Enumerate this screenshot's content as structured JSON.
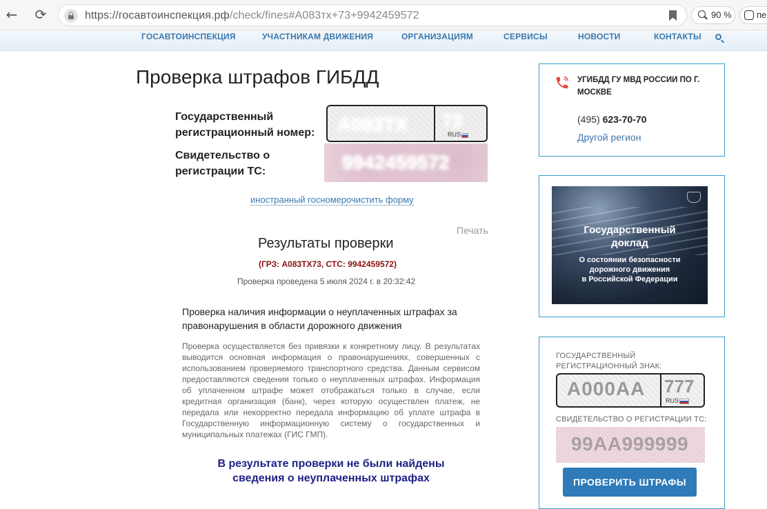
{
  "browser": {
    "url_host": "https://госавтоинспекция.рф",
    "url_path": "/check/fines#A083тх+73+9942459572",
    "zoom": "90 %",
    "translate_label": "пе"
  },
  "site_nav": {
    "items": [
      "ГОСАВТОИНСПЕКЦИЯ",
      "УЧАСТНИКАМ ДВИЖЕНИЯ",
      "ОРГАНИЗАЦИЯМ",
      "СЕРВИСЫ",
      "НОВОСТИ",
      "КОНТАКТЫ"
    ]
  },
  "main": {
    "title": "Проверка штрафов ГИБДД",
    "form": {
      "plate_label_line1": "Государственный",
      "plate_label_line2": "регистрационный номер:",
      "plate_value": "А083ТХ",
      "plate_region": "73",
      "plate_country": "RUS",
      "sts_label_line1": "Свидетельство о",
      "sts_label_line2": "регистрации ТС:",
      "sts_value": "9942459572",
      "foreign_link": "иностранный госномер",
      "clear_link": "очистить форму"
    },
    "print_label": "Печать",
    "results": {
      "title": "Результаты проверки",
      "subtitle": "(ГРЗ: А083ТХ73, СТС: 9942459572)",
      "date": "Проверка проведена 5 июля 2024 г. в 20:32:42",
      "section_heading": "Проверка наличия информации о неуплаченных штрафах за правонарушения в области дорожного движения",
      "section_body": "Проверка осуществляется без привязки к конкретному лицу. В результатах выводится основная информация о правонарушениях, совершенных с использованием проверяемого транспортного средства. Данным сервисом предоставляются сведения только о неуплаченных штрафах. Информация об уплаченном штрафе может отображаться только в случае, если кредитная организация (банк), через которую осуществлен платеж, не передала или некорректно передала информацию об уплате штрафа в Государственную информационную систему о государственных и муниципальных платежах (ГИС ГМП).",
      "message_line1": "В результате проверки не были найдены",
      "message_line2": "сведения о неуплаченных штрафах"
    }
  },
  "sidebar": {
    "contact": {
      "heading": "УГИБДД ГУ МВД РОССИИ ПО Г. МОСКВЕ",
      "phone_code": "(495)",
      "phone_number": "623-70-70",
      "region_link": "Другой регион"
    },
    "banner": {
      "title_line1": "Государственный",
      "title_line2": "доклад",
      "text_line1": "О состоянии безопасности",
      "text_line2": "дорожного движения",
      "text_line3": "в Российской Федерации"
    },
    "widget": {
      "plate_label_line1": "ГОСУДАРСТВЕННЫЙ",
      "plate_label_line2": "РЕГИСТРАЦИОННЫЙ ЗНАК:",
      "plate_example": "А000АА",
      "region_example": "777",
      "country": "RUS",
      "sts_label": "СВИДЕТЕЛЬСТВО О РЕГИСТРАЦИИ ТС:",
      "sts_example": "99АА999999",
      "button": "ПРОВЕРИТЬ ШТРАФЫ"
    }
  },
  "colors": {
    "link": "#3a78ad",
    "sidebar_border": "#3a9ac8",
    "button": "#2f7ab8",
    "subtitle": "#8b1010",
    "message": "#1f1f85",
    "phone_icon": "#e04b3c"
  }
}
